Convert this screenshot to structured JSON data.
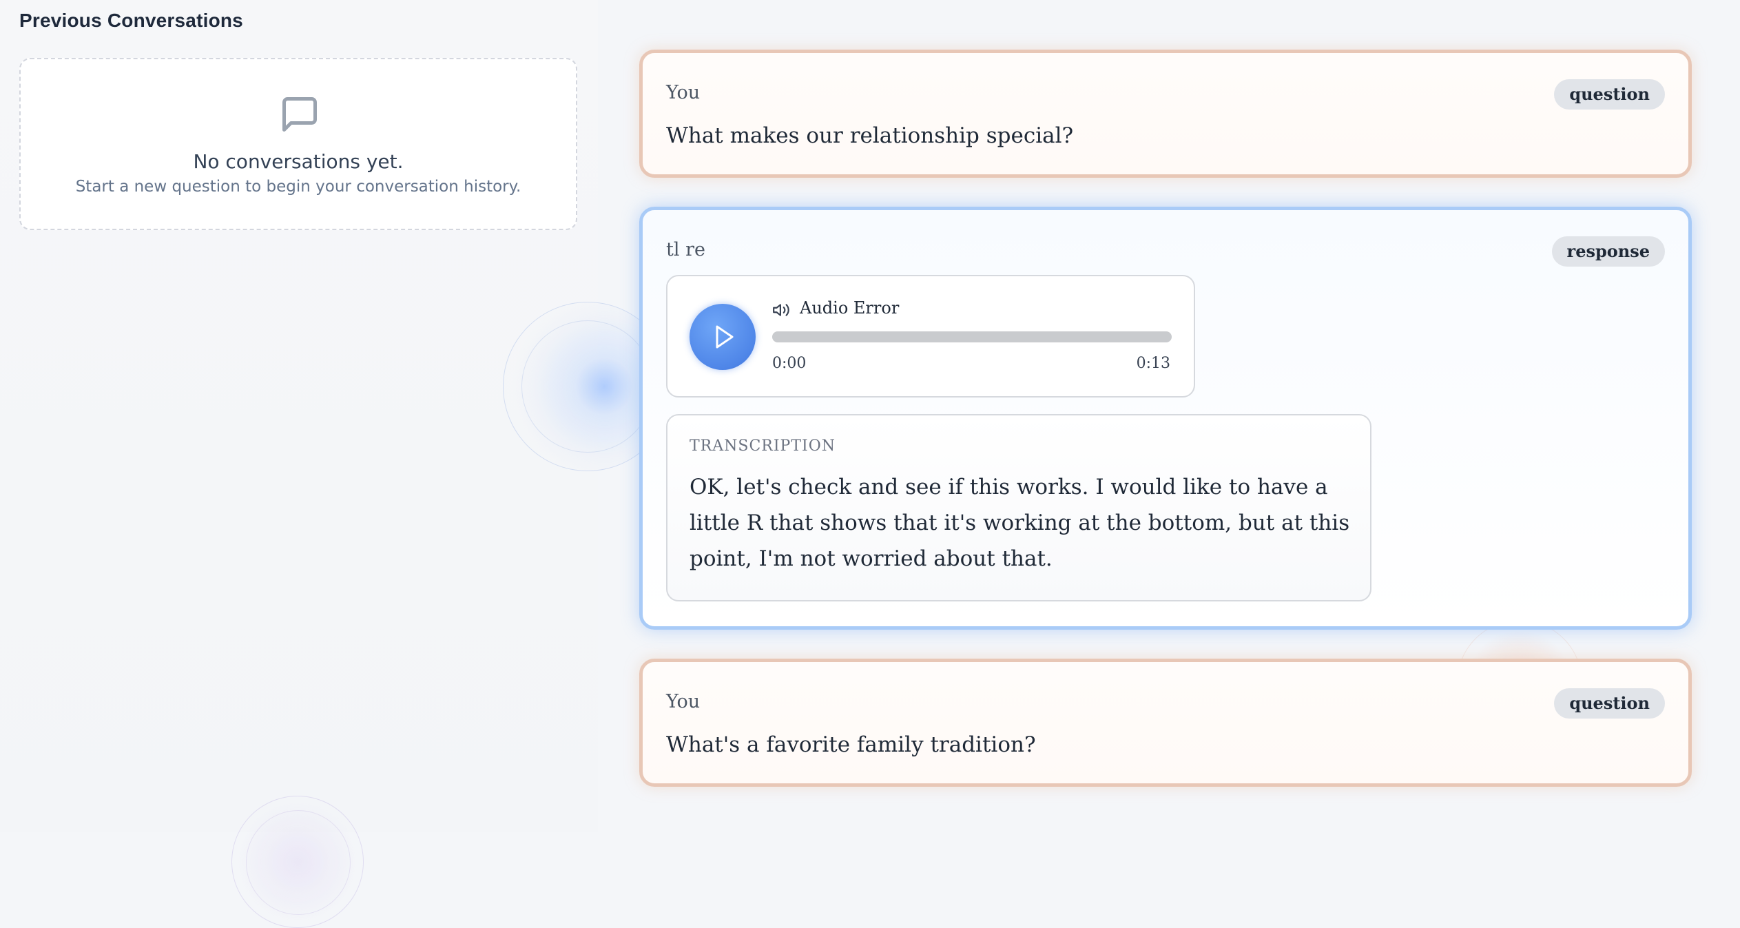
{
  "sidebar": {
    "title": "Previous Conversations",
    "empty_state": {
      "icon": "message-square-icon",
      "title": "No conversations yet.",
      "subtitle": "Start a new question to begin your conversation history."
    }
  },
  "messages": [
    {
      "sender": "You",
      "badge": "question",
      "text": "What makes our relationship special?"
    },
    {
      "sender": "tl re",
      "badge": "response",
      "audio": {
        "status": "Audio Error",
        "current_time": "0:00",
        "total_time": "0:13",
        "progress": 0
      },
      "transcription": {
        "label": "TRANSCRIPTION",
        "text": "OK, let's check and see if this works. I would like to have a little R that shows that it's working at the bottom, but at this point, I'm not worried about that."
      }
    },
    {
      "sender": "You",
      "badge": "question",
      "text": "What's a favorite family tradition?"
    }
  ],
  "colors": {
    "question_border": "#e8c7b6",
    "response_border": "#a9cbf7",
    "accent_blue": "#4f86e8",
    "badge_bg": "#e1e4e9"
  }
}
